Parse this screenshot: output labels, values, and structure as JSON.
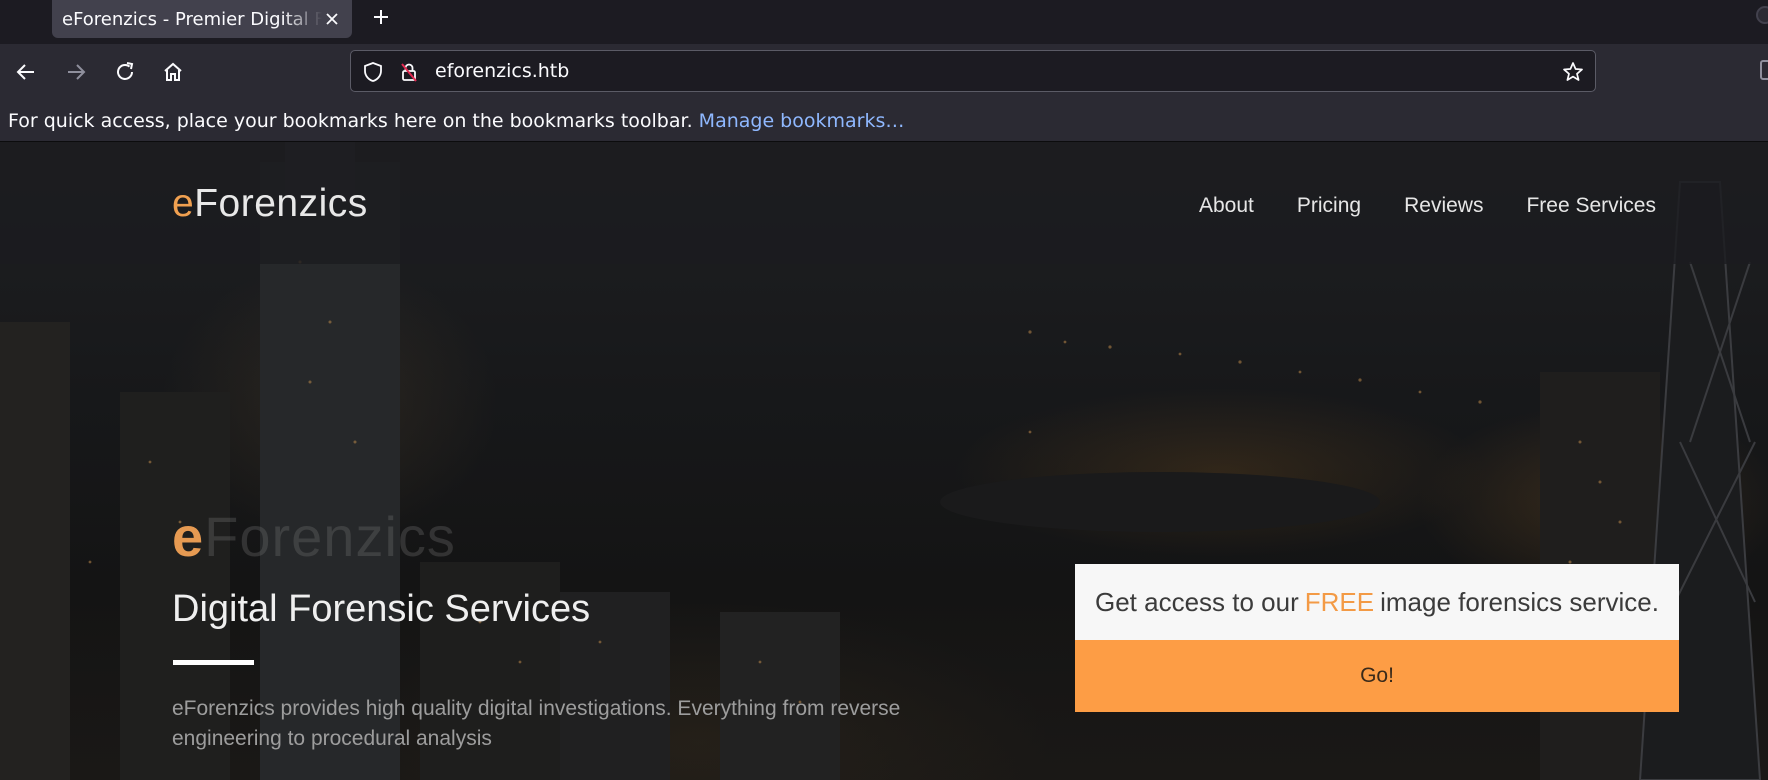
{
  "browser": {
    "tab_title": "eForenzics - Premier Digital Forensics",
    "url": "eforenzics.htb",
    "bookmarks_message": "For quick access, place your bookmarks here on the bookmarks toolbar.",
    "bookmarks_link": "Manage bookmarks…"
  },
  "site": {
    "logo_accent": "e",
    "logo_rest": "Forenzics",
    "nav": [
      "About",
      "Pricing",
      "Reviews",
      "Free Services"
    ],
    "hero": {
      "brand_accent": "e",
      "brand_rest": "Forenzics",
      "title": "Digital Forensic Services",
      "description": "eForenzics provides high quality digital investigations. Everything from reverse engineering to procedural analysis"
    },
    "cta": {
      "text_before": "Get access to our",
      "highlight": "FREE",
      "text_after": "image forensics service.",
      "button_label": "Go!"
    }
  },
  "colors": {
    "accent": "#fd9d45",
    "browser_toolbar": "#2b2a33",
    "link": "#8fb8ff"
  }
}
